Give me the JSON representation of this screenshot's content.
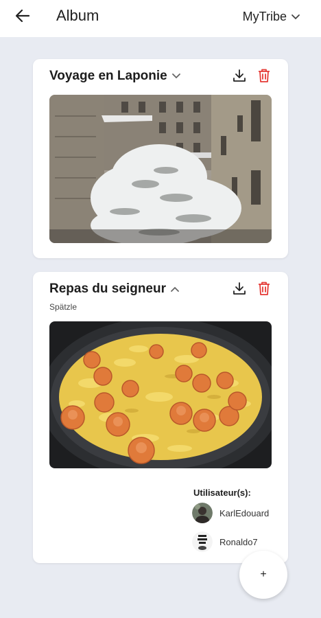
{
  "header": {
    "title": "Album",
    "back_icon": "arrow-left-icon",
    "tribe_name": "MyTribe",
    "tribe_icon": "chevron-down-icon"
  },
  "albums": [
    {
      "title": "Voyage en Laponie",
      "subtitle": "",
      "expanded": false,
      "photo": "snowy tree in courtyard between buildings"
    },
    {
      "title": "Repas du seigneur",
      "subtitle": "Spätzle",
      "expanded": true,
      "photo": "pan of spätzle with sausage slices",
      "users_label": "Utilisateur(s):",
      "users": [
        {
          "name": "KarlEdouard"
        },
        {
          "name": "Ronaldo7"
        }
      ]
    }
  ],
  "fab": {
    "label": "+"
  },
  "colors": {
    "delete": "#e53935",
    "background": "#e8ebf2"
  }
}
